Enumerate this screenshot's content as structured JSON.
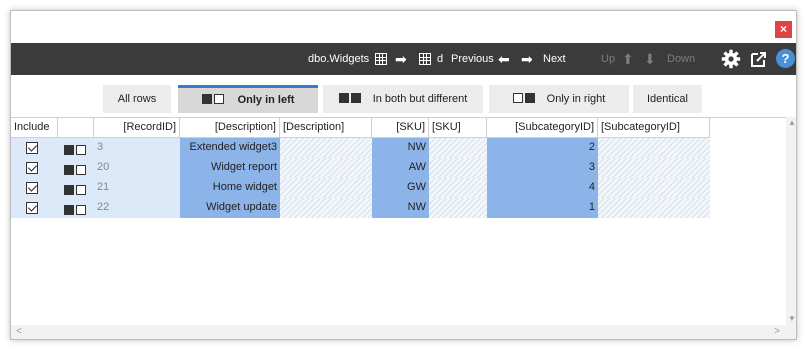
{
  "window": {
    "close_label": "×"
  },
  "toolbar": {
    "table_name": "dbo.Widgets",
    "target_name": "d",
    "previous_label": "Previous",
    "next_label": "Next",
    "up_label": "Up",
    "down_label": "Down",
    "arrow_right": "➡",
    "arrow_left": "⬅",
    "arrow_up": "⬆",
    "arrow_down": "⬇",
    "help_label": "?",
    "icons": [
      "grid-icon",
      "arrow-right-icon",
      "arrow-left-icon",
      "arrow-up-icon",
      "arrow-down-icon",
      "gear-icon",
      "export-icon",
      "help-icon"
    ]
  },
  "tabs": {
    "all_rows": "All rows",
    "only_in_left": "Only in left",
    "in_both_different": "In both but different",
    "only_in_right": "Only in right",
    "identical": "Identical",
    "active": "only_in_left"
  },
  "columns": {
    "include": "Include",
    "record_id": "[RecordID]",
    "description_left": "[Description]",
    "description_right": "[Description]",
    "sku_left": "[SKU]",
    "sku_right": "[SKU]",
    "subcat_left": "[SubcategoryID]",
    "subcat_right": "[SubcategoryID]"
  },
  "rows": [
    {
      "included": true,
      "record_id": "3",
      "description": "Extended widget3",
      "sku": "NW",
      "subcategory_id": "2"
    },
    {
      "included": true,
      "record_id": "20",
      "description": "Widget report",
      "sku": "AW",
      "subcategory_id": "3"
    },
    {
      "included": true,
      "record_id": "21",
      "description": "Home widget",
      "sku": "GW",
      "subcategory_id": "4"
    },
    {
      "included": true,
      "record_id": "22",
      "description": "Widget update",
      "sku": "NW",
      "subcategory_id": "1"
    }
  ],
  "scroll": {
    "up": "▲",
    "down": "▼",
    "left": "<",
    "right": ">"
  },
  "colors": {
    "toolbar_bg": "#3b3b3b",
    "active_tab_accent": "#3a78c8",
    "left_only_cell": "#8db4e8",
    "row_bg": "#dce9f8",
    "close_red": "#e04343"
  }
}
